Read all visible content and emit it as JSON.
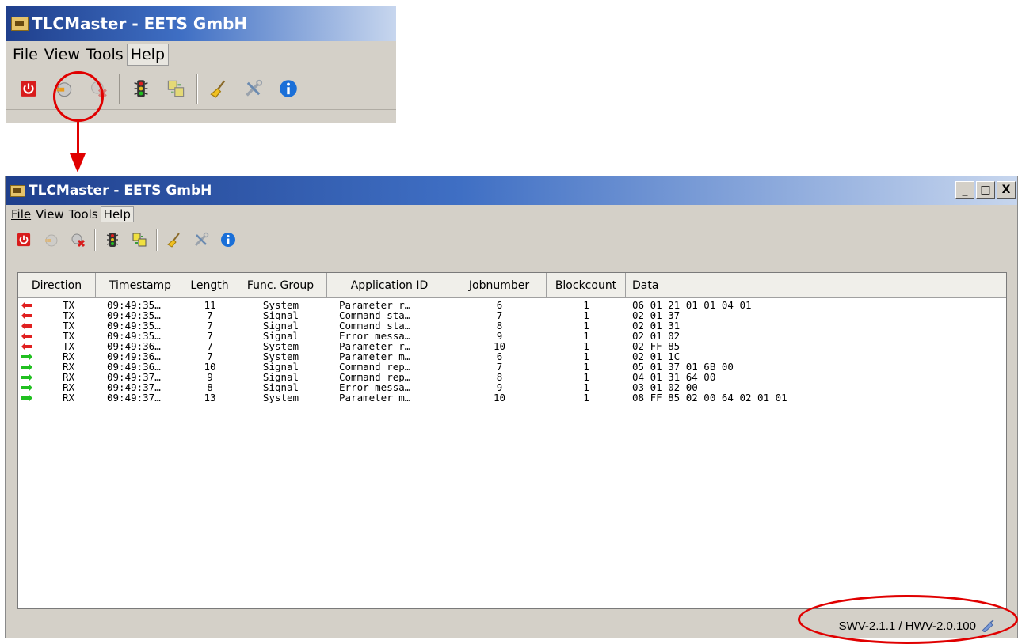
{
  "window": {
    "title": "TLCMaster - EETS GmbH"
  },
  "menu": [
    {
      "label": "File"
    },
    {
      "label": "View"
    },
    {
      "label": "Tools"
    },
    {
      "label": "Help"
    }
  ],
  "toolbar": {
    "icons": [
      "power-icon",
      "connect-icon",
      "disconnect-icon",
      "traffic-light-icon",
      "transfer-icon",
      "broom-icon",
      "tools-icon",
      "info-icon"
    ]
  },
  "colors": {
    "tx_arrow": "#e02020",
    "rx_arrow": "#20c020",
    "callout": "#e00000"
  },
  "table": {
    "columns": [
      "Direction",
      "Timestamp",
      "Length",
      "Func. Group",
      "Application ID",
      "Jobnumber",
      "Blockcount",
      "Data"
    ],
    "rows": [
      {
        "direction": "TX",
        "timestamp": "09:49:35…",
        "length": "11",
        "func_group": "System",
        "application_id": "Parameter r…",
        "jobnumber": "6",
        "blockcount": "1",
        "data": "06 01 21 01 01 04 01"
      },
      {
        "direction": "TX",
        "timestamp": "09:49:35…",
        "length": "7",
        "func_group": "Signal",
        "application_id": "Command sta…",
        "jobnumber": "7",
        "blockcount": "1",
        "data": "02 01 37"
      },
      {
        "direction": "TX",
        "timestamp": "09:49:35…",
        "length": "7",
        "func_group": "Signal",
        "application_id": "Command sta…",
        "jobnumber": "8",
        "blockcount": "1",
        "data": "02 01 31"
      },
      {
        "direction": "TX",
        "timestamp": "09:49:35…",
        "length": "7",
        "func_group": "Signal",
        "application_id": "Error messa…",
        "jobnumber": "9",
        "blockcount": "1",
        "data": "02 01 02"
      },
      {
        "direction": "TX",
        "timestamp": "09:49:36…",
        "length": "7",
        "func_group": "System",
        "application_id": "Parameter r…",
        "jobnumber": "10",
        "blockcount": "1",
        "data": "02 FF 85"
      },
      {
        "direction": "RX",
        "timestamp": "09:49:36…",
        "length": "7",
        "func_group": "System",
        "application_id": "Parameter m…",
        "jobnumber": "6",
        "blockcount": "1",
        "data": "02 01 1C"
      },
      {
        "direction": "RX",
        "timestamp": "09:49:36…",
        "length": "10",
        "func_group": "Signal",
        "application_id": "Command rep…",
        "jobnumber": "7",
        "blockcount": "1",
        "data": "05 01 37 01 6B 00"
      },
      {
        "direction": "RX",
        "timestamp": "09:49:37…",
        "length": "9",
        "func_group": "Signal",
        "application_id": "Command rep…",
        "jobnumber": "8",
        "blockcount": "1",
        "data": "04 01 31 64 00"
      },
      {
        "direction": "RX",
        "timestamp": "09:49:37…",
        "length": "8",
        "func_group": "Signal",
        "application_id": "Error messa…",
        "jobnumber": "9",
        "blockcount": "1",
        "data": "03 01 02 00"
      },
      {
        "direction": "RX",
        "timestamp": "09:49:37…",
        "length": "13",
        "func_group": "System",
        "application_id": "Parameter m…",
        "jobnumber": "10",
        "blockcount": "1",
        "data": "08 FF 85 02 00 64 02 01 01"
      }
    ]
  },
  "status": {
    "version": "SWV-2.1.1 / HWV-2.0.100"
  },
  "window_buttons": {
    "minimize": "_",
    "maximize": "□",
    "close": "X"
  }
}
